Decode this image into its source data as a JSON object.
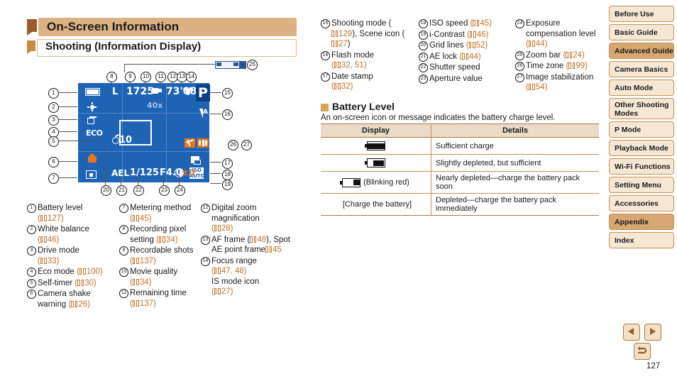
{
  "headings": {
    "title": "On-Screen Information",
    "subtitle": "Shooting (Information Display)",
    "battery_section": "Battery Level",
    "battery_intro": "An on-screen icon or message indicates the battery charge level."
  },
  "lcd": {
    "recording_pixel": "L",
    "recordable_shots": "1725",
    "remaining_time": "73'08\"",
    "digital_zoom": "40x",
    "self_timer": "10",
    "eco": "ECO",
    "mode": "P",
    "flash": "A",
    "ae_lock": "AEL",
    "shutter_speed": "1/125",
    "aperture": "F4.0",
    "exposure_comp": "0",
    "iso_label": "ISO",
    "iso_value": "AUTO"
  },
  "legend": {
    "col1": [
      {
        "n": "1",
        "text": "Battery level",
        "page": "127"
      },
      {
        "n": "2",
        "text": "White balance",
        "page": "46"
      },
      {
        "n": "3",
        "text": "Drive mode",
        "page": "33"
      },
      {
        "n": "4",
        "text": "Eco mode",
        "page": "100",
        "inline": true
      },
      {
        "n": "5",
        "text": "Self-timer",
        "page": "30",
        "inline": true
      },
      {
        "n": "6",
        "text": "Camera shake warning",
        "page": "26",
        "inline": true
      }
    ],
    "col2": [
      {
        "n": "7",
        "text": "Metering method",
        "page": "45"
      },
      {
        "n": "8",
        "text": "Recording pixel setting",
        "page": "34",
        "inline": true
      },
      {
        "n": "9",
        "text": "Recordable shots",
        "page": "137"
      },
      {
        "n": "10",
        "text": "Movie quality",
        "page": "34"
      },
      {
        "n": "11",
        "text": "Remaining time",
        "page": "137"
      }
    ],
    "col3": [
      {
        "n": "12",
        "text": "Digital zoom magnification",
        "page": "28"
      },
      {
        "n": "13",
        "text": "AF frame (",
        "page": "48",
        "suffix": "),",
        "text2": "Spot AE point frame",
        "page2": "45"
      },
      {
        "n": "14",
        "text": "Focus range",
        "page": "47, 48",
        "text2": "IS mode icon",
        "page2": "27"
      }
    ],
    "col4": [
      {
        "n": "15",
        "text": "Shooting mode (",
        "page": "129",
        "suffix": "), Scene",
        "text2": "icon (",
        "page2": "27",
        "suffix2": ")"
      },
      {
        "n": "16",
        "text": "Flash mode",
        "page": "32, 51"
      },
      {
        "n": "17",
        "text": "Date stamp",
        "page": "32"
      }
    ],
    "col5": [
      {
        "n": "18",
        "text": "ISO speed",
        "page": "45",
        "inline": true
      },
      {
        "n": "19",
        "text": "i-Contrast",
        "page": "46",
        "inline": true
      },
      {
        "n": "20",
        "text": "Grid lines",
        "page": "52",
        "inline": true
      },
      {
        "n": "21",
        "text": "AE lock",
        "page": "44",
        "inline": true
      },
      {
        "n": "22",
        "text": "Shutter speed"
      },
      {
        "n": "23",
        "text": "Aperture value"
      }
    ],
    "col6": [
      {
        "n": "24",
        "text": "Exposure compensation level",
        "page": "44"
      },
      {
        "n": "25",
        "text": "Zoom bar",
        "page": "24",
        "inline": true
      },
      {
        "n": "26",
        "text": "Time zone",
        "page": "99",
        "inline": true
      },
      {
        "n": "27",
        "text": "Image stabilization",
        "page": "54"
      }
    ]
  },
  "battery_table": {
    "headers": [
      "Display",
      "Details"
    ],
    "rows": [
      {
        "display": "",
        "icon": "battery-full",
        "details": "Sufficient charge"
      },
      {
        "display": "",
        "icon": "battery-half",
        "details": "Slightly depleted, but sufficient"
      },
      {
        "display": "(Blinking red)",
        "icon": "battery-low",
        "details": "Nearly depleted—charge the battery pack soon"
      },
      {
        "display": "[Charge the battery]",
        "icon": "none",
        "details": "Depleted—charge the battery pack immediately"
      }
    ]
  },
  "sidebar": {
    "items": [
      {
        "label": "Before Use",
        "active": false
      },
      {
        "label": "Basic Guide",
        "active": false
      },
      {
        "label": "Advanced Guide",
        "active": true
      },
      {
        "label": "Camera Basics",
        "active": false
      },
      {
        "label": "Auto Mode",
        "active": false
      },
      {
        "label": "Other Shooting Modes",
        "active": false,
        "two_line": true
      },
      {
        "label": "P Mode",
        "active": false
      },
      {
        "label": "Playback Mode",
        "active": false
      },
      {
        "label": "Wi-Fi Functions",
        "active": false
      },
      {
        "label": "Setting Menu",
        "active": false
      },
      {
        "label": "Accessories",
        "active": false
      },
      {
        "label": "Appendix",
        "active": true
      },
      {
        "label": "Index",
        "active": false
      }
    ]
  },
  "footer": {
    "page_number": "127",
    "prev_label": "previous-page",
    "next_label": "next-page",
    "back_label": "return"
  },
  "colors": {
    "heading_bar": "#dcb183",
    "accent_brown": "#9c5b28",
    "page_ref": "#c4722b",
    "lcd_blue": "#1f63b4",
    "badge_blue": "#0d3f86",
    "orange": "#e8741c",
    "sidebar_active": "#d7a771"
  }
}
